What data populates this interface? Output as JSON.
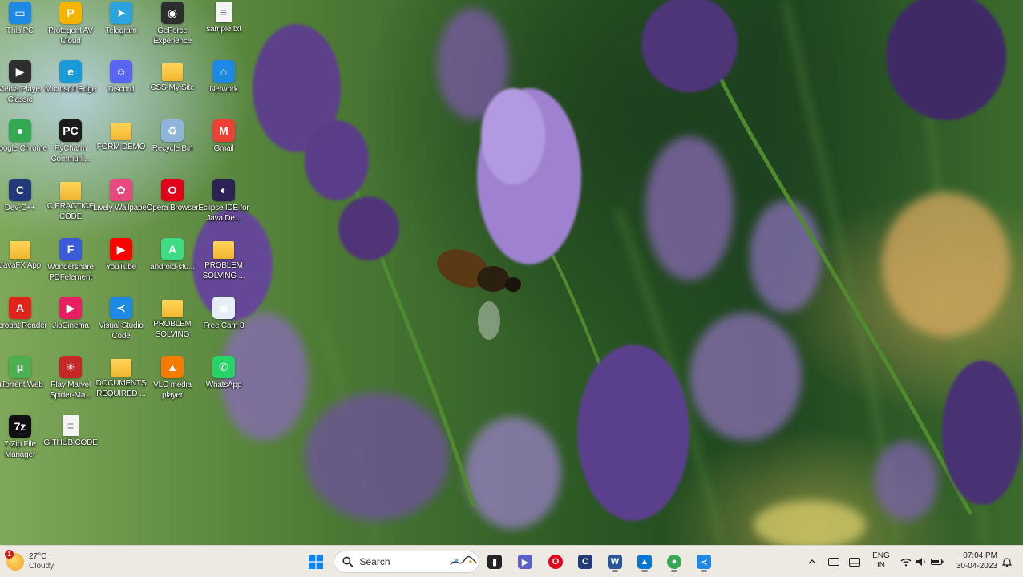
{
  "desktop": {
    "icons": [
      {
        "label": "This PC",
        "icon": "monitor-icon",
        "color": "#1e88e5"
      },
      {
        "label": "Protegent AV Cloud",
        "icon": "shield-icon",
        "color": "#f4b400"
      },
      {
        "label": "Telegram",
        "icon": "telegram-icon",
        "color": "#2aa3df"
      },
      {
        "label": "GeForce Experience",
        "icon": "nvidia-icon",
        "color": "#2d2d2d"
      },
      {
        "label": "sample.txt",
        "icon": "text-file-icon",
        "color": "#f4f4f4"
      },
      {
        "label": "Media Player Classic",
        "icon": "media-player-icon",
        "color": "#2f2f2f"
      },
      {
        "label": "Microsoft Edge",
        "icon": "edge-icon",
        "color": "#1a9ad6"
      },
      {
        "label": "Discord",
        "icon": "discord-icon",
        "color": "#5865f2"
      },
      {
        "label": "CSS-My Site",
        "icon": "folder-icon",
        "color": "#f2b630"
      },
      {
        "label": "Network",
        "icon": "network-icon",
        "color": "#1e88e5"
      },
      {
        "label": "Google Chrome",
        "icon": "chrome-icon",
        "color": "#34a853"
      },
      {
        "label": "PyCharm Communi...",
        "icon": "pycharm-icon",
        "color": "#1c1c1c"
      },
      {
        "label": "FORM DEMO",
        "icon": "folder-icon",
        "color": "#f2b630"
      },
      {
        "label": "Recycle Bin",
        "icon": "recycle-bin-icon",
        "color": "#8fb4d9"
      },
      {
        "label": "Gmail",
        "icon": "gmail-icon",
        "color": "#ea4335"
      },
      {
        "label": "Dev-C++",
        "icon": "devcpp-icon",
        "color": "#223a7a"
      },
      {
        "label": "C PRACTICE CODE",
        "icon": "folder-icon",
        "color": "#f2b630"
      },
      {
        "label": "Lively Wallpaper",
        "icon": "lively-icon",
        "color": "#e84a7f"
      },
      {
        "label": "Opera Browser",
        "icon": "opera-icon",
        "color": "#e3001b"
      },
      {
        "label": "Eclipse IDE for Java De...",
        "icon": "eclipse-icon",
        "color": "#2c2255"
      },
      {
        "label": "JavaFX App",
        "icon": "folder-icon",
        "color": "#f2b630"
      },
      {
        "label": "Wondershare PDFelement",
        "icon": "pdfelement-icon",
        "color": "#3b5bdb"
      },
      {
        "label": "YouTube",
        "icon": "youtube-icon",
        "color": "#ff0000"
      },
      {
        "label": "android-stu...",
        "icon": "android-studio-icon",
        "color": "#3ddc84"
      },
      {
        "label": "PROBLEM SOLVING ...",
        "icon": "folder-icon",
        "color": "#f2b630"
      },
      {
        "label": "Acrobat Reader",
        "icon": "acrobat-icon",
        "color": "#e0241b"
      },
      {
        "label": "JioCinema",
        "icon": "jiocinema-icon",
        "color": "#e91e63"
      },
      {
        "label": "Visual Studio Code",
        "icon": "vscode-icon",
        "color": "#1e88e5"
      },
      {
        "label": "PROBLEM SOLVING",
        "icon": "folder-icon",
        "color": "#f2b630"
      },
      {
        "label": "Free Cam 8",
        "icon": "free-cam-icon",
        "color": "#e6eef6"
      },
      {
        "label": "uTorrent Web",
        "icon": "utorrent-icon",
        "color": "#4caf50"
      },
      {
        "label": "Play Marvel Spider-Ma...",
        "icon": "spiderman-icon",
        "color": "#c62828"
      },
      {
        "label": "DOCUMENTS REQUIRED ...",
        "icon": "folder-icon",
        "color": "#f2b630"
      },
      {
        "label": "VLC media player",
        "icon": "vlc-icon",
        "color": "#f57c00"
      },
      {
        "label": "WhatsApp",
        "icon": "whatsapp-icon",
        "color": "#25d366"
      },
      {
        "label": "7-Zip File Manager",
        "icon": "7zip-icon",
        "color": "#111111"
      },
      {
        "label": "GITHUB CODE",
        "icon": "file-icon",
        "color": "#f4f4f4"
      }
    ]
  },
  "taskbar": {
    "weather": {
      "temperature": "27°C",
      "condition": "Cloudy",
      "badge": "1"
    },
    "search": {
      "placeholder": "Search"
    },
    "apps": [
      {
        "name": "start-button",
        "icon": "windows-start-icon",
        "color": "#0a84ff"
      },
      {
        "name": "task-view-button",
        "icon": "task-view-icon",
        "color": "#222222"
      },
      {
        "name": "meet-app-button",
        "icon": "video-chat-icon",
        "color": "#5b5fc7"
      },
      {
        "name": "opera-taskbar-button",
        "icon": "opera-icon",
        "color": "#e3001b"
      },
      {
        "name": "devcpp-taskbar-button",
        "icon": "devcpp-icon",
        "color": "#223a7a"
      },
      {
        "name": "word-taskbar-button",
        "icon": "document-app-icon",
        "color": "#2b579a"
      },
      {
        "name": "photos-taskbar-button",
        "icon": "photos-icon",
        "color": "#0078d4"
      },
      {
        "name": "chrome-taskbar-button",
        "icon": "chrome-icon",
        "color": "#34a853"
      },
      {
        "name": "vscode-taskbar-button",
        "icon": "vscode-icon",
        "color": "#1e88e5"
      }
    ],
    "tray": {
      "language_line1": "ENG",
      "language_line2": "IN",
      "time": "07:04 PM",
      "date": "30-04-2023"
    }
  }
}
